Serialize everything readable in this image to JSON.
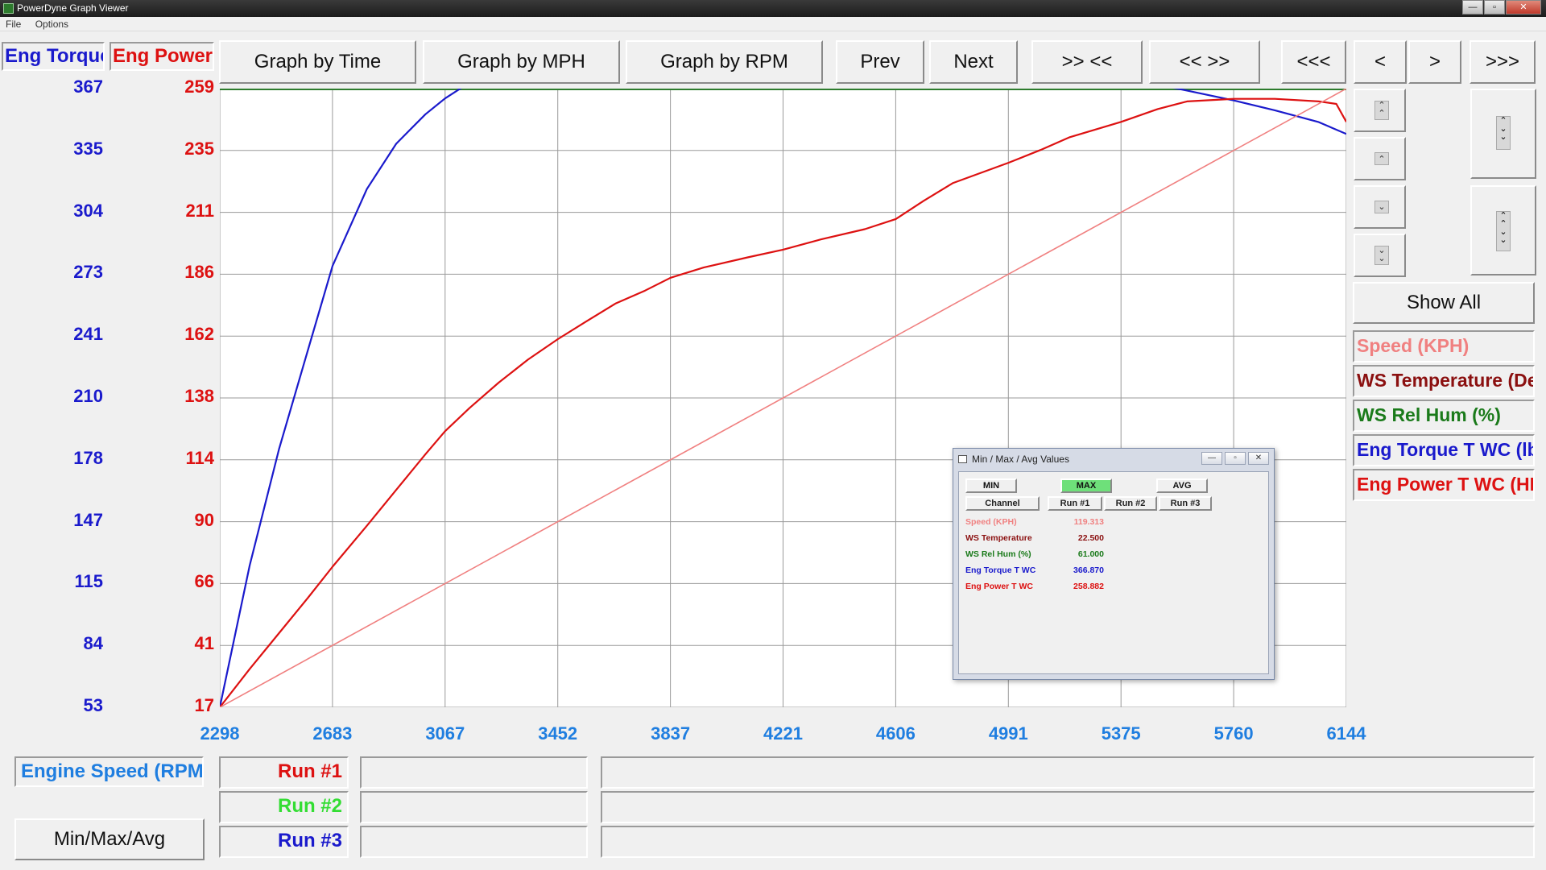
{
  "window": {
    "title": "PowerDyne Graph Viewer",
    "controls": [
      "—",
      "▫",
      "✕"
    ]
  },
  "menu": [
    "File",
    "Options"
  ],
  "axis_headers": {
    "left": "Eng Torque T WC",
    "right": "Eng Power T WC"
  },
  "toolbar": {
    "graph_by_time": "Graph by Time",
    "graph_by_mph": "Graph by MPH",
    "graph_by_rpm": "Graph by RPM",
    "prev": "Prev",
    "next": "Next",
    "zoom_in": ">> <<",
    "zoom_out": "<< >>",
    "first": "<<<",
    "back": "<",
    "forward": ">",
    "last": ">>>"
  },
  "side": {
    "show_all": "Show All",
    "legend": [
      {
        "label": "Speed (KPH)",
        "color": "#f08080"
      },
      {
        "label": "WS Temperature (Deg C)",
        "color": "#8b1010"
      },
      {
        "label": "WS Rel Hum (%)",
        "color": "#1a7a1a"
      },
      {
        "label": "Eng Torque T WC (lb-ft)",
        "color": "#1a1acc"
      },
      {
        "label": "Eng Power T WC (HP)",
        "color": "#dd1111"
      }
    ]
  },
  "bottom": {
    "x_channel": "Engine Speed (RPM)",
    "min_max_avg": "Min/Max/Avg",
    "runs": [
      {
        "label": "Run #1",
        "color": "#dd1111"
      },
      {
        "label": "Run #2",
        "color": "#33dd33"
      },
      {
        "label": "Run #3",
        "color": "#1a1acc"
      }
    ]
  },
  "dialog": {
    "title": "Min / Max / Avg Values",
    "tabs": [
      "MIN",
      "MAX",
      "AVG"
    ],
    "active_tab": "MAX",
    "columns": [
      "Channel",
      "Run #1",
      "Run #2",
      "Run #3"
    ],
    "rows": [
      {
        "channel": "Speed (KPH)",
        "run1": "119.313",
        "color": "#f08080"
      },
      {
        "channel": "WS Temperature",
        "run1": "22.500",
        "color": "#8b1010"
      },
      {
        "channel": "WS Rel Hum (%)",
        "run1": "61.000",
        "color": "#1a7a1a"
      },
      {
        "channel": "Eng Torque T WC",
        "run1": "366.870",
        "color": "#1a1acc"
      },
      {
        "channel": "Eng Power T WC",
        "run1": "258.882",
        "color": "#dd1111"
      }
    ]
  },
  "chart_data": {
    "type": "line",
    "xlabel": "Engine Speed (RPM)",
    "x_ticks": [
      2298,
      2683,
      3067,
      3452,
      3837,
      4221,
      4606,
      4991,
      5375,
      5760,
      6144
    ],
    "xlim": [
      2298,
      6144
    ],
    "y_left": {
      "label": "Eng Torque T WC",
      "ticks": [
        367,
        335,
        304,
        273,
        241,
        210,
        178,
        147,
        115,
        84,
        53
      ],
      "lim": [
        53,
        367
      ],
      "color": "#1a1acc"
    },
    "y_right": {
      "label": "Eng Power T WC",
      "ticks": [
        259,
        235,
        211,
        186,
        162,
        138,
        114,
        90,
        66,
        41,
        17
      ],
      "lim": [
        17,
        259
      ],
      "color": "#dd1111"
    },
    "grid": true,
    "series": [
      {
        "name": "Eng Torque T WC",
        "axis": "left",
        "color": "#1a1acc",
        "x": [
          2298,
          2400,
          2500,
          2600,
          2683,
          2800,
          2900,
          3000,
          3067,
          3150,
          3250,
          3350,
          3452,
          3550,
          3650,
          3750,
          3837,
          3900,
          4000,
          4100,
          4221,
          4350,
          4500,
          4606,
          4700,
          4800,
          4900,
          4991,
          5100,
          5200,
          5375,
          5500,
          5600,
          5760,
          5900,
          6050,
          6144
        ],
        "y": [
          53,
          125,
          184,
          235,
          277,
          316,
          339,
          354,
          362,
          370,
          377,
          382,
          386,
          390,
          392,
          394,
          395,
          394.5,
          393,
          391,
          389,
          386,
          383,
          380,
          381,
          381.5,
          381,
          380,
          378,
          376,
          372,
          369,
          366,
          361,
          356,
          350,
          344
        ]
      },
      {
        "name": "Eng Power T WC",
        "axis": "right",
        "color": "#dd1111",
        "x": [
          2298,
          2400,
          2500,
          2600,
          2683,
          2800,
          2900,
          3000,
          3067,
          3150,
          3250,
          3350,
          3452,
          3550,
          3650,
          3750,
          3837,
          3950,
          4100,
          4221,
          4350,
          4500,
          4606,
          4700,
          4800,
          4991,
          5100,
          5200,
          5375,
          5500,
          5600,
          5760,
          5900,
          6050,
          6110,
          6144
        ],
        "y": [
          17,
          32,
          46,
          60,
          72,
          88,
          102,
          116,
          125,
          134,
          144,
          153,
          161,
          168,
          175,
          180,
          185,
          189,
          193,
          196,
          200,
          204,
          208,
          215,
          222,
          230,
          235,
          240,
          246,
          251,
          254,
          255,
          255,
          254,
          253,
          246
        ]
      },
      {
        "name": "Speed (KPH)",
        "axis": "norm",
        "color": "#f08080",
        "x": [
          2298,
          6144
        ],
        "y": [
          0,
          1
        ]
      }
    ]
  }
}
